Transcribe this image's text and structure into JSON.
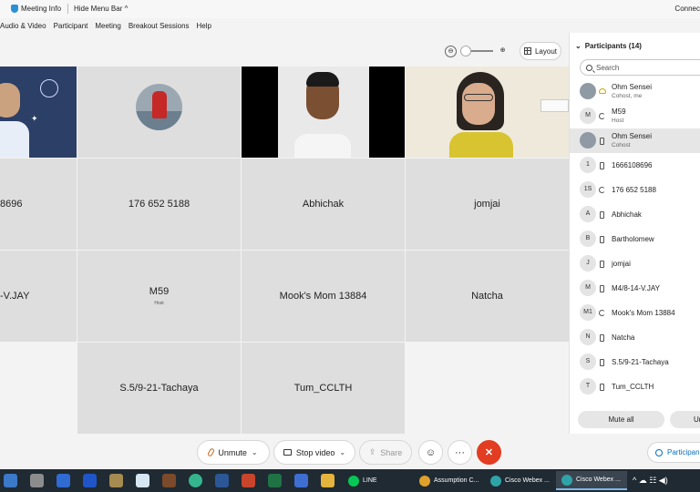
{
  "topbar": {
    "meeting_info": "Meeting Info",
    "hide_menu_bar": "Hide Menu Bar ^",
    "status": "Connec"
  },
  "menu": [
    "Audio & Video",
    "Participant",
    "Meeting",
    "Breakout Sessions",
    "Help"
  ],
  "view": {
    "layout_label": "Layout",
    "zoom_out": "⊖",
    "zoom_in": "⊕"
  },
  "tiles": [
    {
      "name": "8696",
      "sub": ""
    },
    {
      "name": "176 652 5188",
      "sub": ""
    },
    {
      "name": "Abhichak",
      "sub": ""
    },
    {
      "name": "jomjai",
      "sub": ""
    },
    {
      "name": "-V.JAY",
      "sub": ""
    },
    {
      "name": "M59",
      "sub": "Host"
    },
    {
      "name": "Mook's Mom 13884",
      "sub": ""
    },
    {
      "name": "Natcha",
      "sub": ""
    },
    {
      "name": "S.5/9-21-Tachaya",
      "sub": ""
    },
    {
      "name": "Tum_CCLTH",
      "sub": ""
    }
  ],
  "panel": {
    "title": "Participants (14)",
    "search_placeholder": "Search",
    "participants": [
      {
        "avatar": "",
        "name": "Ohm Sensei",
        "role": "Cohost, me",
        "icon": "cloud"
      },
      {
        "avatar": "M",
        "name": "M59",
        "role": "Host",
        "icon": "sync"
      },
      {
        "avatar": "",
        "name": "Ohm Sensei",
        "role": "Cohost",
        "icon": "device"
      },
      {
        "avatar": "1",
        "name": "1666108696",
        "role": "",
        "icon": "device"
      },
      {
        "avatar": "1S",
        "name": "176 652 5188",
        "role": "",
        "icon": "sync"
      },
      {
        "avatar": "A",
        "name": "Abhichak",
        "role": "",
        "icon": "device"
      },
      {
        "avatar": "B",
        "name": "Bartholomew",
        "role": "",
        "icon": "device"
      },
      {
        "avatar": "J",
        "name": "jomjai",
        "role": "",
        "icon": "device"
      },
      {
        "avatar": "M",
        "name": "M4/8-14-V.JAY",
        "role": "",
        "icon": "device"
      },
      {
        "avatar": "M1",
        "name": "Mook's Mom 13884",
        "role": "",
        "icon": "sync"
      },
      {
        "avatar": "N",
        "name": "Natcha",
        "role": "",
        "icon": "device"
      },
      {
        "avatar": "S",
        "name": "S.5/9-21-Tachaya",
        "role": "",
        "icon": "device"
      },
      {
        "avatar": "T",
        "name": "Tum_CCLTH",
        "role": "",
        "icon": "device"
      }
    ],
    "mute_all": "Mute all",
    "unmute_all": "Ur"
  },
  "controls": {
    "unmute": "Unmute",
    "stop_video": "Stop video",
    "share": "Share",
    "participants": "Participan",
    "more": "···",
    "reactions": "☺",
    "end": "✕"
  },
  "taskbar": {
    "apps": [
      "LINE",
      "Assumption C...",
      "Cisco Webex ...",
      "Cisco Webex ..."
    ],
    "tray": "^ ☁ ☷ ◀)"
  }
}
